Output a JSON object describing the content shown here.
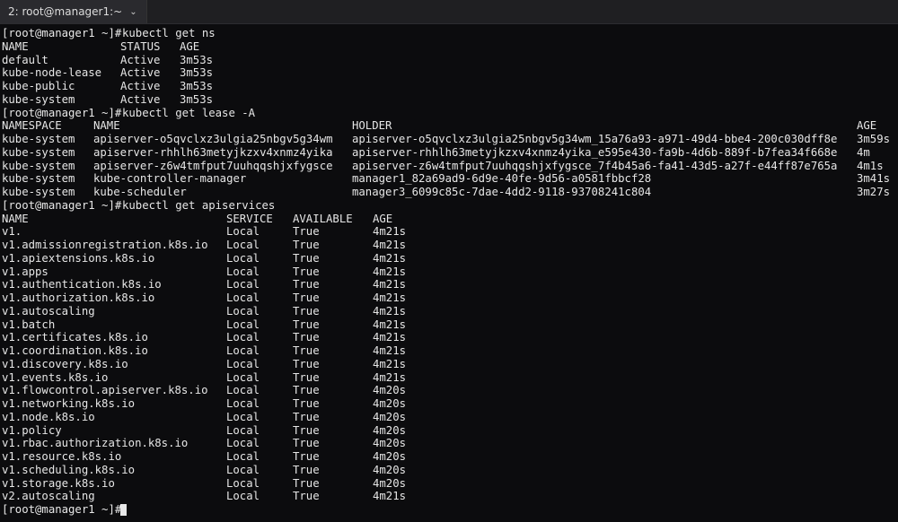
{
  "tab": {
    "title": "2: root@manager1:~"
  },
  "prompt": "[root@manager1 ~]# ",
  "cmd_ns": "kubectl get ns",
  "ns": {
    "headers": [
      "NAME",
      "STATUS",
      "AGE"
    ],
    "rows": [
      [
        "default",
        "Active",
        "3m53s"
      ],
      [
        "kube-node-lease",
        "Active",
        "3m53s"
      ],
      [
        "kube-public",
        "Active",
        "3m53s"
      ],
      [
        "kube-system",
        "Active",
        "3m53s"
      ]
    ]
  },
  "cmd_lease": "kubectl get lease -A",
  "lease": {
    "headers": [
      "NAMESPACE",
      "NAME",
      "HOLDER",
      "AGE"
    ],
    "rows": [
      [
        "kube-system",
        "apiserver-o5qvclxz3ulgia25nbgv5g34wm",
        "apiserver-o5qvclxz3ulgia25nbgv5g34wm_15a76a93-a971-49d4-bbe4-200c030dff8e",
        "3m59s"
      ],
      [
        "kube-system",
        "apiserver-rhhlh63metyjkzxv4xnmz4yika",
        "apiserver-rhhlh63metyjkzxv4xnmz4yika_e595e430-fa9b-4d6b-889f-b7fea34f668e",
        "4m"
      ],
      [
        "kube-system",
        "apiserver-z6w4tmfput7uuhqqshjxfygsce",
        "apiserver-z6w4tmfput7uuhqqshjxfygsce_7f4b45a6-fa41-43d5-a27f-e44ff87e765a",
        "4m1s"
      ],
      [
        "kube-system",
        "kube-controller-manager",
        "manager1_82a69ad9-6d9e-40fe-9d56-a0581fbbcf28",
        "3m41s"
      ],
      [
        "kube-system",
        "kube-scheduler",
        "manager3_6099c85c-7dae-4dd2-9118-93708241c804",
        "3m27s"
      ]
    ]
  },
  "cmd_api": "kubectl get apiservices",
  "api": {
    "headers": [
      "NAME",
      "SERVICE",
      "AVAILABLE",
      "AGE"
    ],
    "rows": [
      [
        "v1.",
        "Local",
        "True",
        "4m21s"
      ],
      [
        "v1.admissionregistration.k8s.io",
        "Local",
        "True",
        "4m21s"
      ],
      [
        "v1.apiextensions.k8s.io",
        "Local",
        "True",
        "4m21s"
      ],
      [
        "v1.apps",
        "Local",
        "True",
        "4m21s"
      ],
      [
        "v1.authentication.k8s.io",
        "Local",
        "True",
        "4m21s"
      ],
      [
        "v1.authorization.k8s.io",
        "Local",
        "True",
        "4m21s"
      ],
      [
        "v1.autoscaling",
        "Local",
        "True",
        "4m21s"
      ],
      [
        "v1.batch",
        "Local",
        "True",
        "4m21s"
      ],
      [
        "v1.certificates.k8s.io",
        "Local",
        "True",
        "4m21s"
      ],
      [
        "v1.coordination.k8s.io",
        "Local",
        "True",
        "4m21s"
      ],
      [
        "v1.discovery.k8s.io",
        "Local",
        "True",
        "4m21s"
      ],
      [
        "v1.events.k8s.io",
        "Local",
        "True",
        "4m21s"
      ],
      [
        "v1.flowcontrol.apiserver.k8s.io",
        "Local",
        "True",
        "4m20s"
      ],
      [
        "v1.networking.k8s.io",
        "Local",
        "True",
        "4m20s"
      ],
      [
        "v1.node.k8s.io",
        "Local",
        "True",
        "4m20s"
      ],
      [
        "v1.policy",
        "Local",
        "True",
        "4m20s"
      ],
      [
        "v1.rbac.authorization.k8s.io",
        "Local",
        "True",
        "4m20s"
      ],
      [
        "v1.resource.k8s.io",
        "Local",
        "True",
        "4m20s"
      ],
      [
        "v1.scheduling.k8s.io",
        "Local",
        "True",
        "4m20s"
      ],
      [
        "v1.storage.k8s.io",
        "Local",
        "True",
        "4m20s"
      ],
      [
        "v2.autoscaling",
        "Local",
        "True",
        "4m21s"
      ]
    ]
  }
}
